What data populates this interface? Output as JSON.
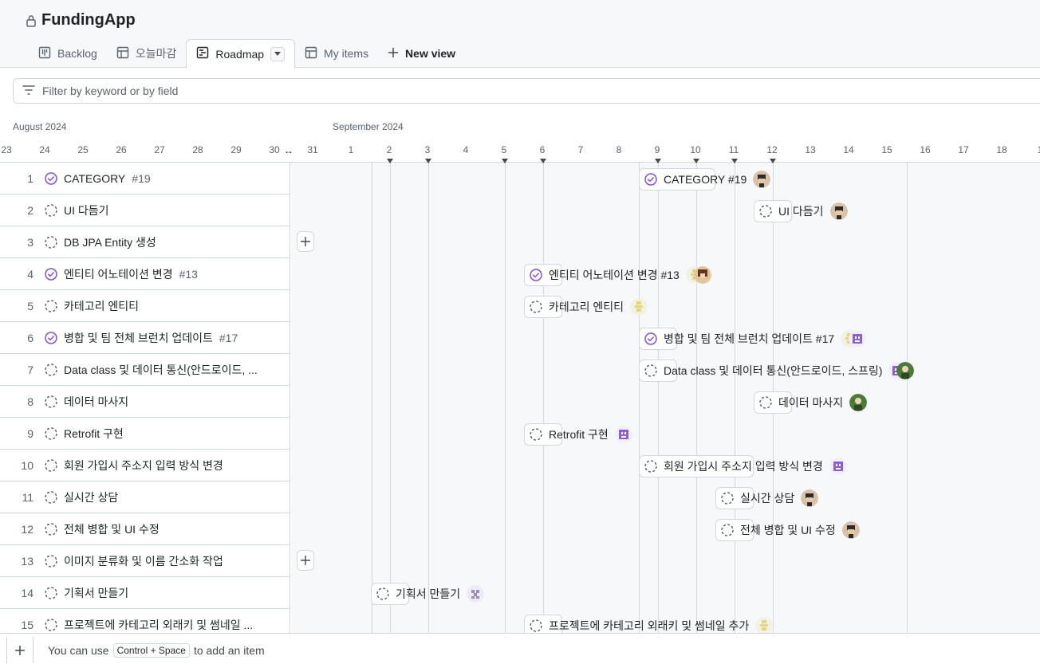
{
  "app": {
    "title": "FundingApp"
  },
  "tabs": [
    {
      "label": "Backlog",
      "icon": "board-icon"
    },
    {
      "label": "오늘마감",
      "icon": "table-icon"
    },
    {
      "label": "Roadmap",
      "icon": "roadmap-icon",
      "active": true
    },
    {
      "label": "My items",
      "icon": "table-icon"
    }
  ],
  "new_view_label": "New view",
  "filter": {
    "placeholder": "Filter by keyword or by field",
    "value": ""
  },
  "timeline": {
    "months": [
      "August 2024",
      "September 2024"
    ],
    "days": [
      "23",
      "24",
      "25",
      "26",
      "27",
      "28",
      "29",
      "30",
      "31",
      "1",
      "2",
      "3",
      "4",
      "5",
      "6",
      "7",
      "8",
      "9",
      "10",
      "11",
      "12",
      "13",
      "14",
      "15",
      "16",
      "17",
      "18",
      "1"
    ]
  },
  "items": [
    {
      "num": "1",
      "title": "CATEGORY",
      "ref": "#19",
      "status": "done",
      "bar": {
        "label": "CATEGORY #19",
        "avatars": [
          "dark-hair"
        ]
      }
    },
    {
      "num": "2",
      "title": "UI 다듬기",
      "status": "open",
      "bar": {
        "label": "UI 다듬기",
        "avatars": [
          "dark-hair"
        ]
      }
    },
    {
      "num": "3",
      "title": "DB JPA Entity 생성",
      "status": "open",
      "bar": null
    },
    {
      "num": "4",
      "title": "엔티티 어노테이션 변경",
      "ref": "#13",
      "status": "done",
      "bar": {
        "label": "엔티티 어노테이션 변경 #13",
        "avatars": [
          "yellow-pattern",
          "brown-hair"
        ]
      }
    },
    {
      "num": "5",
      "title": "카테고리 엔티티",
      "status": "open",
      "bar": {
        "label": "카테고리 엔티티",
        "avatars": [
          "yellow-pattern"
        ]
      }
    },
    {
      "num": "6",
      "title": "병합 및 팀 전체 브런치 업데이트",
      "ref": "#17",
      "status": "done",
      "bar": {
        "label": "병합 및 팀 전체 브런치 업데이트 #17",
        "avatars": [
          "yellow-pattern",
          "purple-pattern"
        ]
      }
    },
    {
      "num": "7",
      "title": "Data class 및 데이터 통신(안드로이드, ...",
      "status": "open",
      "bar": {
        "label": "Data class 및 데이터 통신(안드로이드, 스프링)",
        "avatars": [
          "purple-pattern",
          "green-photo"
        ]
      }
    },
    {
      "num": "8",
      "title": "데이터 마사지",
      "status": "open",
      "bar": {
        "label": "데이터 마사지",
        "avatars": [
          "green-photo"
        ]
      }
    },
    {
      "num": "9",
      "title": "Retrofit 구현",
      "status": "open",
      "bar": {
        "label": "Retrofit 구현",
        "avatars": [
          "purple-pattern"
        ]
      }
    },
    {
      "num": "10",
      "title": "회원 가입시 주소지 입력 방식 변경",
      "status": "open",
      "bar": {
        "label": "회원 가입시 주소지 입력 방식 변경",
        "avatars": [
          "purple-pattern"
        ]
      }
    },
    {
      "num": "11",
      "title": "실시간 상담",
      "status": "open",
      "bar": {
        "label": "실시간 상담",
        "avatars": [
          "dark-hair"
        ]
      }
    },
    {
      "num": "12",
      "title": "전체 병합 및 UI 수정",
      "status": "open",
      "bar": {
        "label": "전체 병합 및 UI 수정",
        "avatars": [
          "dark-hair"
        ]
      }
    },
    {
      "num": "13",
      "title": "이미지 분류화 및 이름 간소화 작업",
      "status": "open",
      "bar": null
    },
    {
      "num": "14",
      "title": "기획서 만들기",
      "status": "open",
      "bar": {
        "label": "기획서 만들기",
        "avatars": [
          "lavender-pattern"
        ]
      }
    },
    {
      "num": "15",
      "title": "프로젝트에 카테고리 외래키 및 썸네일 ...",
      "status": "open",
      "bar": {
        "label": "프로젝트에 카테고리 외래키 및 썸네일 추가",
        "avatars": [
          "yellow-pattern"
        ]
      }
    }
  ],
  "footer": {
    "prefix": "You can use",
    "shortcut": "Control + Space",
    "suffix": "to add an item"
  },
  "colors": {
    "done": "#8250df",
    "open": "#59636e",
    "border": "#d0d7de",
    "roadmap_bg": "#f6f8fa"
  }
}
